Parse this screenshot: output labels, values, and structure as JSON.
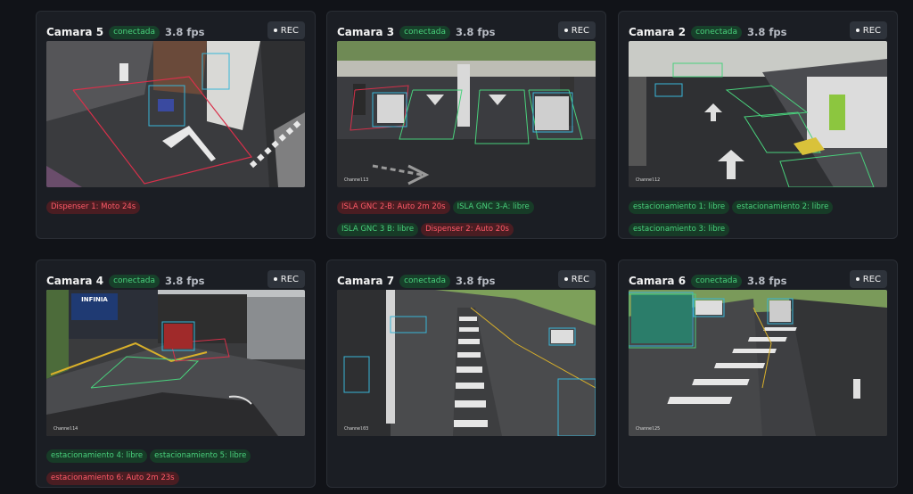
{
  "header": {
    "rec_label": "REC"
  },
  "cameras": [
    {
      "title": "Camara 5",
      "status": "conectada",
      "fps": "3.8 fps",
      "channel": "",
      "events": [
        {
          "text": "Dispenser 1: Moto 24s",
          "state": "busy"
        }
      ]
    },
    {
      "title": "Camara 3",
      "status": "conectada",
      "fps": "3.8 fps",
      "channel": "Channel13",
      "events": [
        {
          "text": "ISLA GNC 2-B: Auto 2m 20s",
          "state": "busy"
        },
        {
          "text": "ISLA GNC 3-A: libre",
          "state": "free"
        },
        {
          "text": "ISLA GNC 3 B: libre",
          "state": "free"
        },
        {
          "text": "Dispenser 2: Auto 20s",
          "state": "busy"
        }
      ]
    },
    {
      "title": "Camara 2",
      "status": "conectada",
      "fps": "3.8 fps",
      "channel": "Channel12",
      "events": [
        {
          "text": "estacionamiento 1: libre",
          "state": "free"
        },
        {
          "text": "estacionamiento 2: libre",
          "state": "free"
        },
        {
          "text": "estacionamiento 3: libre",
          "state": "free"
        }
      ]
    },
    {
      "title": "Camara 4",
      "status": "conectada",
      "fps": "3.8 fps",
      "channel": "Channel14",
      "events": [
        {
          "text": "estacionamiento 4: libre",
          "state": "free"
        },
        {
          "text": "estacionamiento 5: libre",
          "state": "free"
        },
        {
          "text": "estacionamiento 6: Auto 2m 23s",
          "state": "busy"
        }
      ]
    },
    {
      "title": "Camara 7",
      "status": "conectada",
      "fps": "3.8 fps",
      "channel": "Channel03",
      "events": []
    },
    {
      "title": "Camara 6",
      "status": "conectada",
      "fps": "3.8 fps",
      "channel": "Channel25",
      "events": []
    }
  ],
  "signage": {
    "billboard": "INFINIA"
  },
  "colors": {
    "busy": "#ff5a68",
    "free": "#49d17c",
    "box": "#38b6d8"
  }
}
